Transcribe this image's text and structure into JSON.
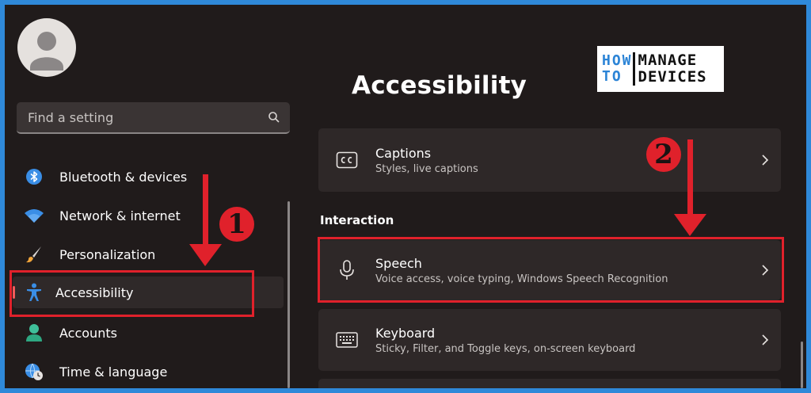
{
  "search": {
    "placeholder": "Find a setting",
    "icon": "search-icon"
  },
  "sidebar": {
    "items": [
      {
        "label": "Bluetooth & devices",
        "icon": "bluetooth-icon"
      },
      {
        "label": "Network & internet",
        "icon": "wifi-icon"
      },
      {
        "label": "Personalization",
        "icon": "brush-icon"
      },
      {
        "label": "Accessibility",
        "icon": "accessibility-icon",
        "selected": true
      },
      {
        "label": "Accounts",
        "icon": "person-icon"
      },
      {
        "label": "Time & language",
        "icon": "globe-clock-icon"
      }
    ]
  },
  "main": {
    "title": "Accessibility",
    "cards": [
      {
        "title": "Captions",
        "subtitle": "Styles, live captions",
        "icon": "captions-icon"
      }
    ],
    "section_label": "Interaction",
    "interaction_cards": [
      {
        "title": "Speech",
        "subtitle": "Voice access, voice typing, Windows Speech Recognition",
        "icon": "microphone-icon"
      },
      {
        "title": "Keyboard",
        "subtitle": "Sticky, Filter, and Toggle keys, on-screen keyboard",
        "icon": "keyboard-icon"
      }
    ]
  },
  "logo": {
    "left": "HOW TO",
    "right": "MANAGE DEVICES"
  },
  "annotations": {
    "step1": "1",
    "step2": "2"
  },
  "colors": {
    "accent_red": "#e0212b",
    "background": "#201b1b",
    "card": "#2e2828",
    "selection_indicator": "#f25a5a",
    "frame_blue": "#2f89d9"
  }
}
